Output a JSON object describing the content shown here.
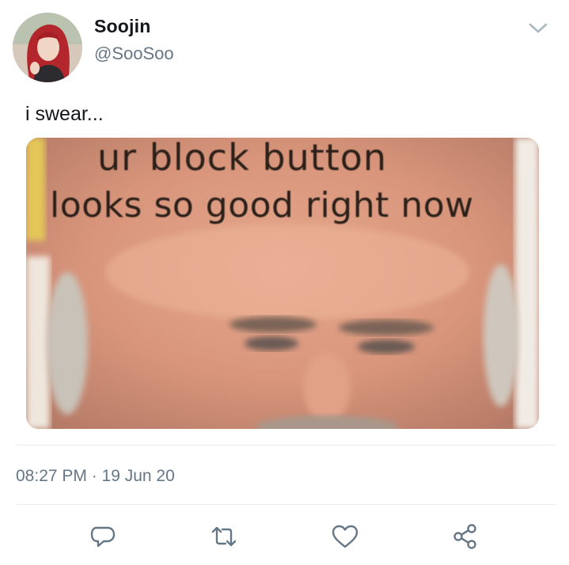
{
  "tweet": {
    "author": {
      "display_name": "Soojin",
      "handle": "@SooSoo"
    },
    "text": "i swear...",
    "media": {
      "caption_line1": "ur  block  button",
      "caption_line2": "looks so good right now"
    },
    "timestamp": "08:27 PM · 19 Jun 20"
  },
  "icons": {
    "menu": "chevron-down-icon",
    "reply": "reply-icon",
    "retweet": "retweet-icon",
    "like": "heart-icon",
    "share": "share-icon"
  },
  "colors": {
    "primary_text": "#14171a",
    "secondary_text": "#657786",
    "divider": "#e6ecf0",
    "icon": "#657786"
  }
}
